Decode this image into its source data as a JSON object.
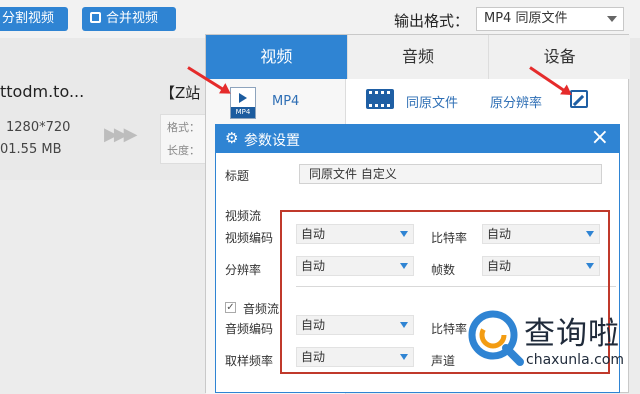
{
  "toolbar": {
    "split_label": "分割视频",
    "merge_label": "合并视频",
    "output_format_label": "输出格式：",
    "output_format_value": "MP4  同原文件"
  },
  "file": {
    "name": "ttodm.to...",
    "resolution": "1280*720",
    "size": "01.55 MB",
    "output_name": "【Z站",
    "info_format": "格式：",
    "info_length": "长度："
  },
  "format_panel": {
    "tabs": [
      "视频",
      "音频",
      "设备"
    ],
    "active_tab": 0,
    "format_item": "MP4",
    "format_icon_text": "MP4",
    "options": {
      "same_file": "同原文件",
      "resolution": "原分辨率"
    }
  },
  "dialog": {
    "title": "参数设置",
    "title_label": "标题",
    "title_value": "同原文件 自定义",
    "video_stream": {
      "heading": "视频流",
      "codec_label": "视频编码",
      "codec_value": "自动",
      "bitrate_label": "比特率",
      "bitrate_value": "自动",
      "resolution_label": "分辨率",
      "resolution_value": "自动",
      "fps_label": "帧数",
      "fps_value": "自动"
    },
    "audio_stream": {
      "heading": "音频流",
      "checked": true,
      "codec_label": "音频编码",
      "codec_value": "自动",
      "bitrate_label": "比特率",
      "samplerate_label": "取样频率",
      "samplerate_value": "自动",
      "channel_label": "声道"
    }
  },
  "watermark": {
    "text": "查询啦",
    "sub": "chaxunla.com"
  },
  "colors": {
    "accent": "#2f84d3",
    "highlight": "#c0392b",
    "annotation": "#e52b2b"
  }
}
